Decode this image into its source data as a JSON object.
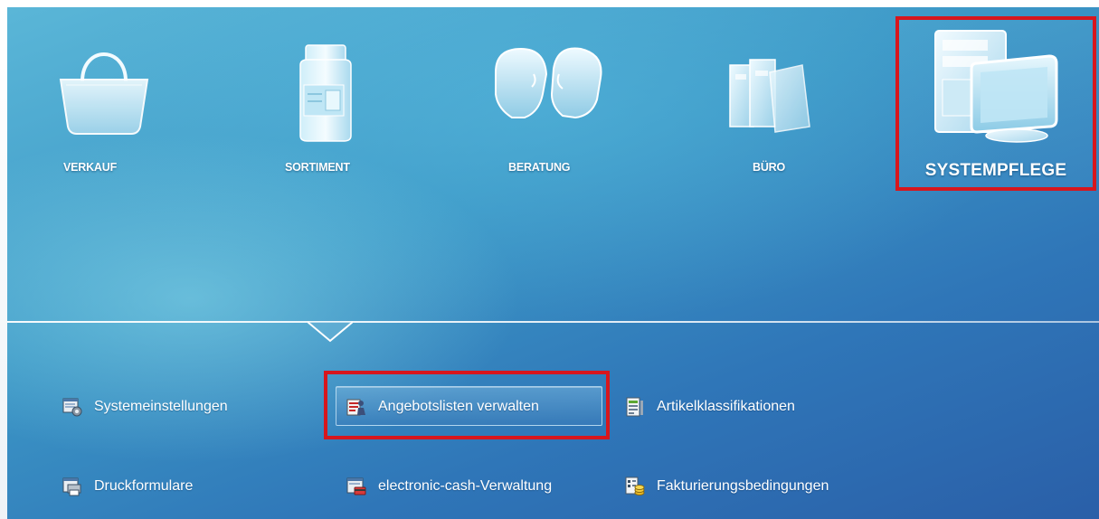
{
  "nav": {
    "items": [
      {
        "id": "verkauf",
        "label": "VERKAUF",
        "icon": "shopping-bag-icon"
      },
      {
        "id": "sortiment",
        "label": "SORTIMENT",
        "icon": "medicine-jar-icon"
      },
      {
        "id": "beratung",
        "label": "BERATUNG",
        "icon": "consultation-heads-icon"
      },
      {
        "id": "buero",
        "label": "BÜRO",
        "icon": "folders-icon"
      },
      {
        "id": "systempflege",
        "label": "SYSTEMPFLEGE",
        "icon": "computer-icon",
        "selected": true
      }
    ]
  },
  "submenu": {
    "items": [
      {
        "label": "Systemeinstellungen",
        "icon": "settings-window-icon"
      },
      {
        "label": "Angebotslisten verwalten",
        "icon": "offer-list-icon",
        "highlighted": true
      },
      {
        "label": "Artikelklassifikationen",
        "icon": "classification-list-icon"
      },
      {
        "label": "Druckformulare",
        "icon": "print-form-icon"
      },
      {
        "label": "electronic-cash-Verwaltung",
        "icon": "ec-window-icon"
      },
      {
        "label": "Fakturierungsbedingungen",
        "icon": "billing-coins-icon"
      }
    ]
  },
  "colors": {
    "background_top": "#5bb7d8",
    "background_bottom": "#2a5fa8",
    "highlight_border": "#d7161d",
    "text": "#ffffff"
  }
}
